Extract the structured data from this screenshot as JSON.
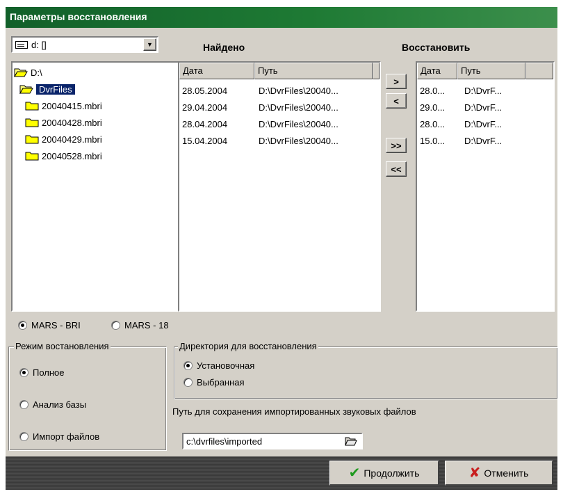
{
  "title": "Параметры восстановления",
  "drive_combo": {
    "value": "d: []"
  },
  "found_label": "Найдено",
  "restore_label": "Восстановить",
  "tree": {
    "items": [
      {
        "label": "D:\\",
        "icon": "folder-open-icon"
      },
      {
        "label": "DvrFiles",
        "icon": "folder-open-icon",
        "selected": true
      },
      {
        "label": "20040415.mbri",
        "icon": "folder-icon"
      },
      {
        "label": "20040428.mbri",
        "icon": "folder-icon"
      },
      {
        "label": "20040429.mbri",
        "icon": "folder-icon"
      },
      {
        "label": "20040528.mbri",
        "icon": "folder-icon"
      }
    ]
  },
  "found_list": {
    "columns": [
      "Дата",
      "Путь"
    ],
    "rows": [
      [
        "28.05.2004",
        "D:\\DvrFiles\\20040..."
      ],
      [
        "29.04.2004",
        "D:\\DvrFiles\\20040..."
      ],
      [
        "28.04.2004",
        "D:\\DvrFiles\\20040..."
      ],
      [
        "15.04.2004",
        "D:\\DvrFiles\\20040..."
      ]
    ]
  },
  "move_buttons": {
    "add": ">",
    "remove": "<",
    "add_all": ">>",
    "remove_all": "<<"
  },
  "restore_list": {
    "columns": [
      "Дата",
      "Путь"
    ],
    "rows": [
      [
        "28.0...",
        "D:\\DvrF..."
      ],
      [
        "29.0...",
        "D:\\DvrF..."
      ],
      [
        "28.0...",
        "D:\\DvrF..."
      ],
      [
        "15.0...",
        "D:\\DvrF..."
      ]
    ]
  },
  "format": {
    "option1": "MARS - BRI",
    "option2": "MARS - 18",
    "selected": "MARS - BRI"
  },
  "mode_group": {
    "title": "Режим востановления",
    "options": [
      "Полное",
      "Анализ базы",
      "Импорт файлов"
    ],
    "selected": "Полное"
  },
  "dir_group": {
    "title": "Директория для восстановления",
    "options": [
      "Установочная",
      "Выбранная"
    ],
    "selected": "Установочная"
  },
  "save_path": {
    "label": "Путь для сохранения импортированных звуковых файлов",
    "value": "c:\\dvrfiles\\imported"
  },
  "buttons": {
    "continue": "Продолжить",
    "cancel": "Отменить"
  },
  "colors": {
    "title_bar": "#1e7a34",
    "selection": "#0a246a",
    "window_bg": "#d4d0c8",
    "ok_check": "#1f9a1f",
    "cancel_x": "#c81e1e"
  }
}
